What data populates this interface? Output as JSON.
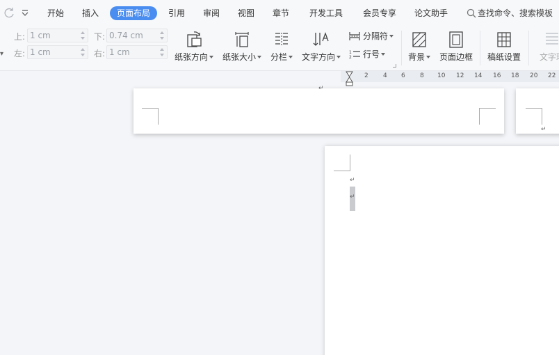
{
  "menu": {
    "tabs": [
      {
        "label": "开始"
      },
      {
        "label": "插入"
      },
      {
        "label": "页面布局",
        "active": true
      },
      {
        "label": "引用"
      },
      {
        "label": "审阅"
      },
      {
        "label": "视图"
      },
      {
        "label": "章节"
      },
      {
        "label": "开发工具"
      },
      {
        "label": "会员专享"
      },
      {
        "label": "论文助手"
      }
    ],
    "search_placeholder": "查找命令、搜索模板"
  },
  "margins": {
    "top_label": "上:",
    "top_value": "1 cm",
    "bottom_label": "下:",
    "bottom_value": "0.74 cm",
    "left_label": "左:",
    "left_value": "1 cm",
    "right_label": "右:",
    "right_value": "1 cm"
  },
  "toolbar": {
    "orientation": "纸张方向",
    "size": "纸张大小",
    "columns": "分栏",
    "text_direction": "文字方向",
    "separator": "分隔符",
    "line_number": "行号",
    "background": "背景",
    "page_border": "页面边框",
    "draft_paper": "稿纸设置",
    "text_wrap": "文字环"
  },
  "ruler": {
    "ticks": [
      "2",
      "4",
      "6",
      "8",
      "10",
      "12",
      "14",
      "16",
      "18",
      "20",
      "22"
    ]
  },
  "colors": {
    "accent": "#4a8df0",
    "menubar_bg": "#f7f8fa",
    "canvas_bg": "#f3f5f8"
  }
}
